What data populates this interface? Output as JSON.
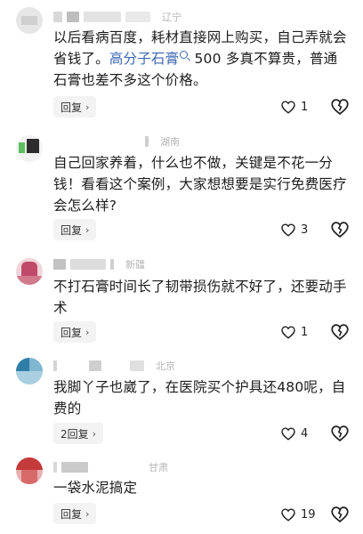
{
  "comments": [
    {
      "region": "辽宁",
      "text_before_link": "以后看病百度，耗材直接网上购买，自己弄就会省钱了。",
      "link": "高分子石膏",
      "text_after_link": " 500 多真不算贵，普通石膏也差不多这个价格。",
      "reply_label": "回复",
      "likes": "1"
    },
    {
      "region": "湖南",
      "text": "自己回家养着，什么也不做，关键是不花一分钱！看看这个案例，大家想想要是实行免费医疗会怎么样?",
      "reply_label": "回复",
      "likes": "3"
    },
    {
      "region": "新疆",
      "text": "不打石膏时间长了韧带损伤就不好了，还要动手术",
      "reply_label": "回复",
      "likes": "1"
    },
    {
      "region": "北京",
      "text": "我脚丫子也崴了，在医院买个护具还480呢，自费的",
      "reply_label": "2回复",
      "likes": "4"
    },
    {
      "region": "甘肃",
      "text": "一袋水泥搞定",
      "reply_label": "回复",
      "likes": "19"
    }
  ],
  "colors": {
    "link": "#3b67b4",
    "region": "#b4b4b4",
    "reply_bg": "#f3f3f3"
  },
  "icons": {
    "like": "heart-icon",
    "dislike": "broken-heart-icon",
    "search": "search-icon",
    "reply_chevron": "chevron-right-icon"
  }
}
